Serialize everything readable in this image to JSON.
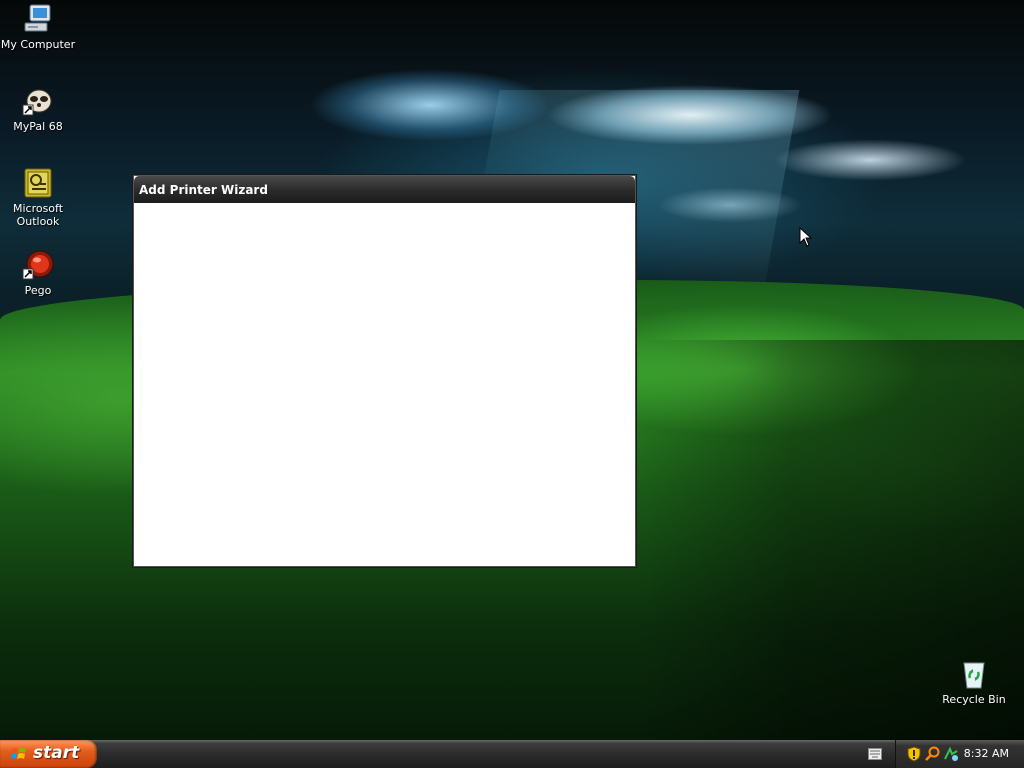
{
  "desktop": {
    "icons": [
      {
        "label": "My Computer",
        "icon": "my-computer-icon"
      },
      {
        "label": "MyPal 68",
        "icon": "mypal-icon"
      },
      {
        "label": "Microsoft Outlook",
        "icon": "outlook-icon"
      },
      {
        "label": "Pego",
        "icon": "pego-icon"
      },
      {
        "label": "Recycle Bin",
        "icon": "recycle-bin-icon"
      }
    ]
  },
  "window": {
    "title": "Add Printer Wizard"
  },
  "taskbar": {
    "start_label": "start",
    "clock": "8:32 AM",
    "tray_icons": [
      "security-shield-icon",
      "search-icon",
      "network-icon"
    ]
  },
  "colors": {
    "start_button": "#e35d1b",
    "taskbar": "#2c2c2c",
    "title_bar": "#2a2a2a"
  }
}
